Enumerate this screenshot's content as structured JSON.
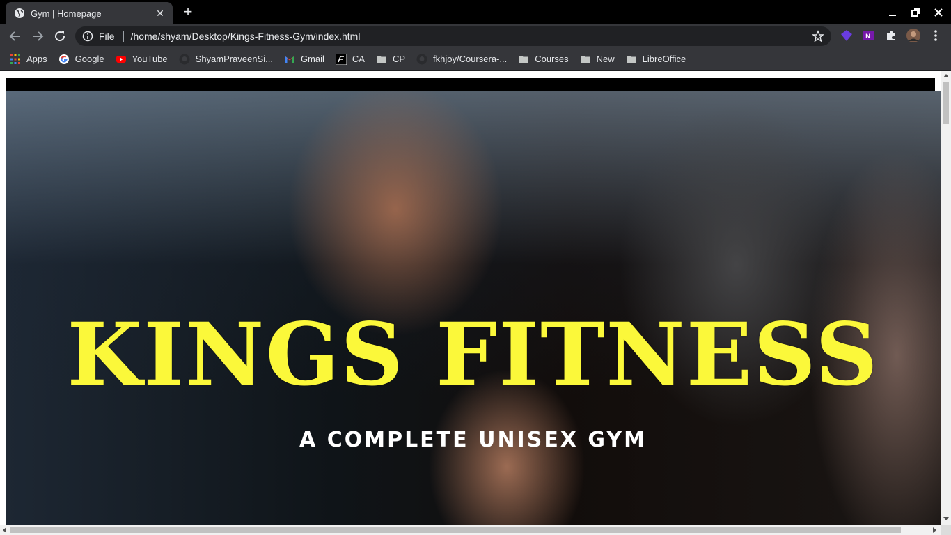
{
  "browser": {
    "tab": {
      "title": "Gym | Homepage",
      "favicon": "globe-icon",
      "close": "✕"
    },
    "new_tab": "+",
    "window_controls": [
      "minimize-icon",
      "restore-icon",
      "close-icon"
    ],
    "omnibox": {
      "scheme_label": "File",
      "url": "/home/shyam/Desktop/Kings-Fitness-Gym/index.html"
    },
    "bookmarks": [
      {
        "label": "Apps",
        "icon": "apps-grid-icon"
      },
      {
        "label": "Google",
        "icon": "google-icon"
      },
      {
        "label": "YouTube",
        "icon": "youtube-icon"
      },
      {
        "label": "ShyamPraveenSi...",
        "icon": "github-icon"
      },
      {
        "label": "Gmail",
        "icon": "gmail-icon"
      },
      {
        "label": "CA",
        "icon": "ca-icon"
      },
      {
        "label": "CP",
        "icon": "folder-icon"
      },
      {
        "label": "fkhjoy/Coursera-...",
        "icon": "github-icon"
      },
      {
        "label": "Courses",
        "icon": "folder-icon"
      },
      {
        "label": "New",
        "icon": "folder-icon"
      },
      {
        "label": "LibreOffice",
        "icon": "folder-icon"
      }
    ]
  },
  "page": {
    "hero": {
      "title": "KINGS FITNESS",
      "subtitle": "A COMPLETE UNISEX GYM"
    }
  },
  "colors": {
    "hero_title": "#fbf83a",
    "hero_subtitle": "#ffffff",
    "tab_bg": "#35363a",
    "frame_bg": "#000000"
  }
}
